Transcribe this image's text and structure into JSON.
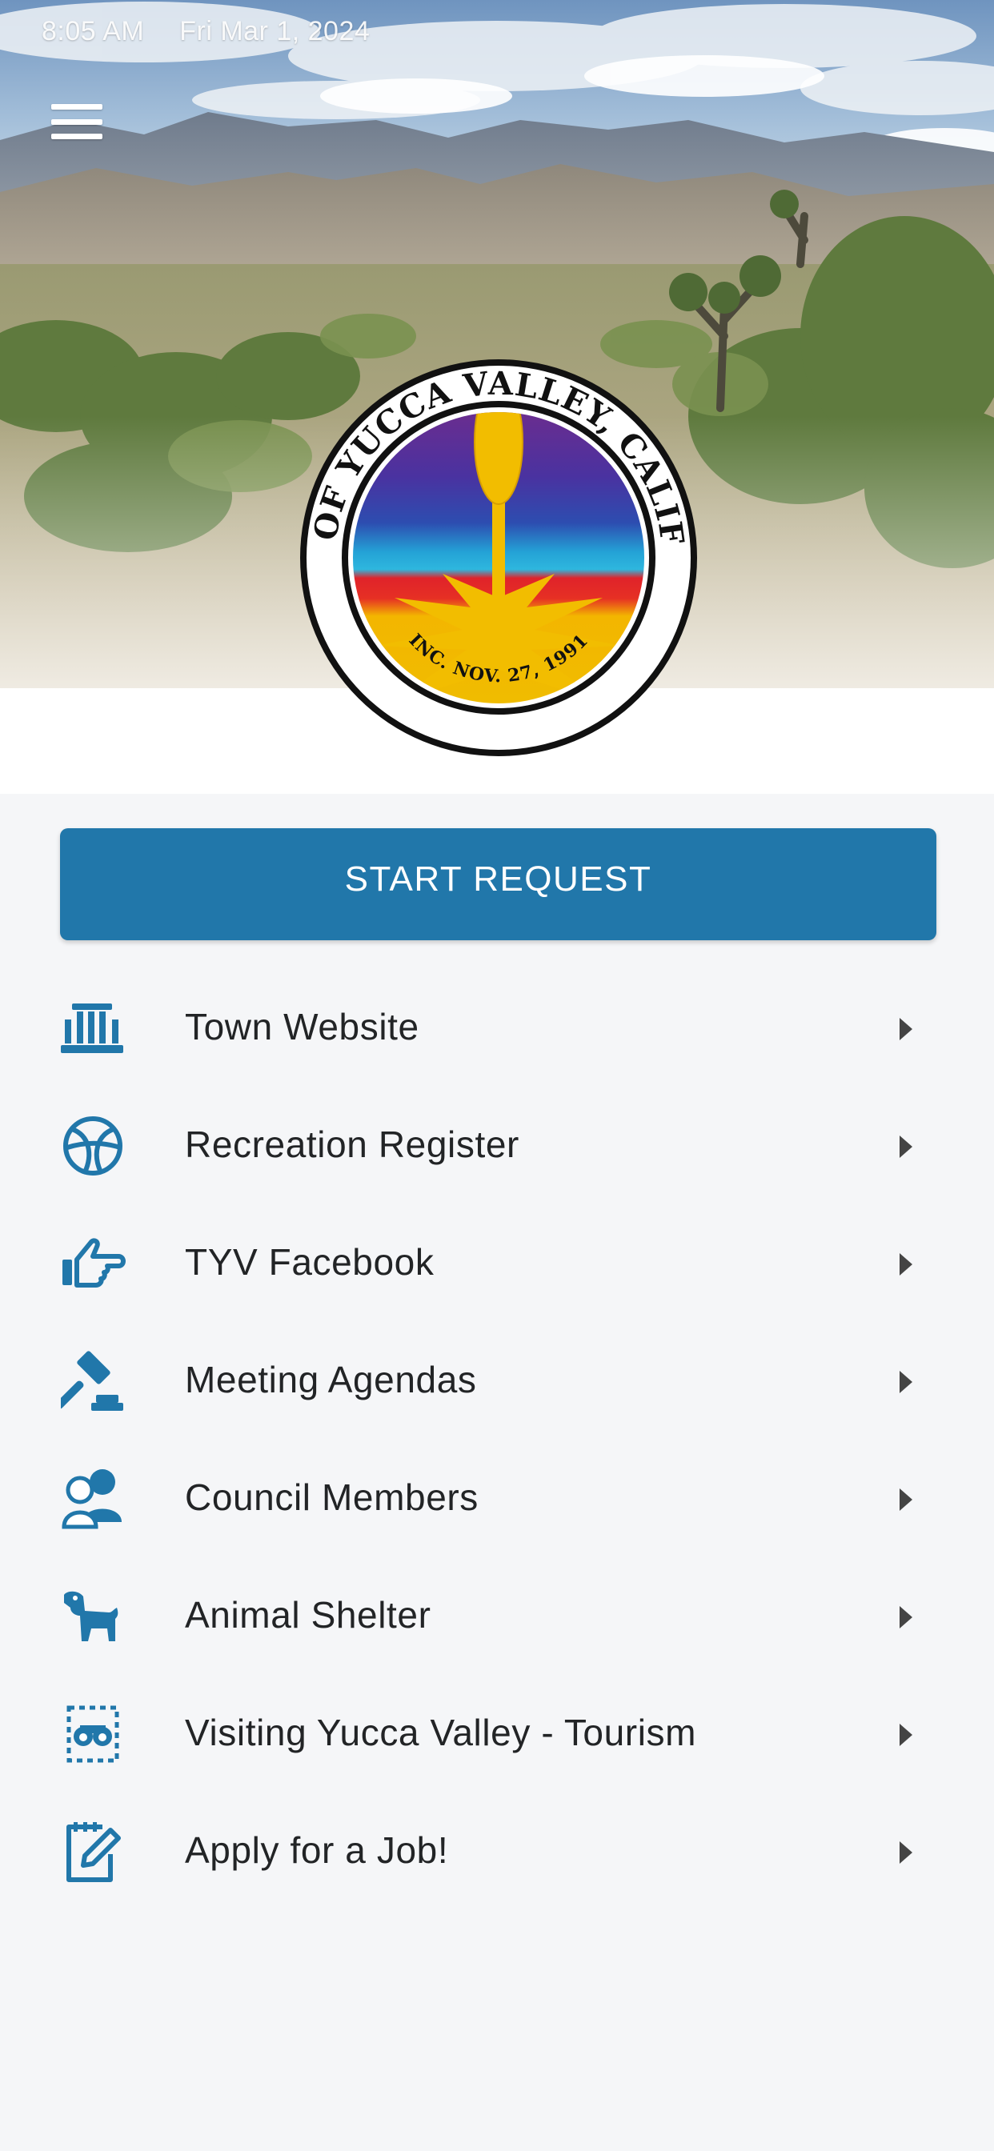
{
  "status_bar": {
    "time": "8:05 AM",
    "date": "Fri Mar 1, 2024"
  },
  "header": {
    "menu_icon": "hamburger-menu-icon",
    "logo": {
      "ring_text": "TOWN OF YUCCA VALLEY, CALIFORNIA",
      "bottom_text": "INC. NOV. 27, 1991"
    }
  },
  "start_request": {
    "label": "START REQUEST"
  },
  "colors": {
    "accent": "#2177aa",
    "icon": "#2177aa",
    "background": "#f5f6f8",
    "text": "#222426",
    "chevron": "#444444"
  },
  "links": [
    {
      "label": "Town Website",
      "icon": "town-hall-icon"
    },
    {
      "label": "Recreation Register",
      "icon": "basketball-icon"
    },
    {
      "label": "TYV Facebook",
      "icon": "pointing-hand-icon"
    },
    {
      "label": "Meeting Agendas",
      "icon": "gavel-icon"
    },
    {
      "label": "Council Members",
      "icon": "user-group-icon"
    },
    {
      "label": "Animal Shelter",
      "icon": "dog-icon"
    },
    {
      "label": "Visiting Yucca Valley - Tourism",
      "icon": "binoculars-icon"
    },
    {
      "label": "Apply for a Job!",
      "icon": "edit-form-icon"
    }
  ]
}
